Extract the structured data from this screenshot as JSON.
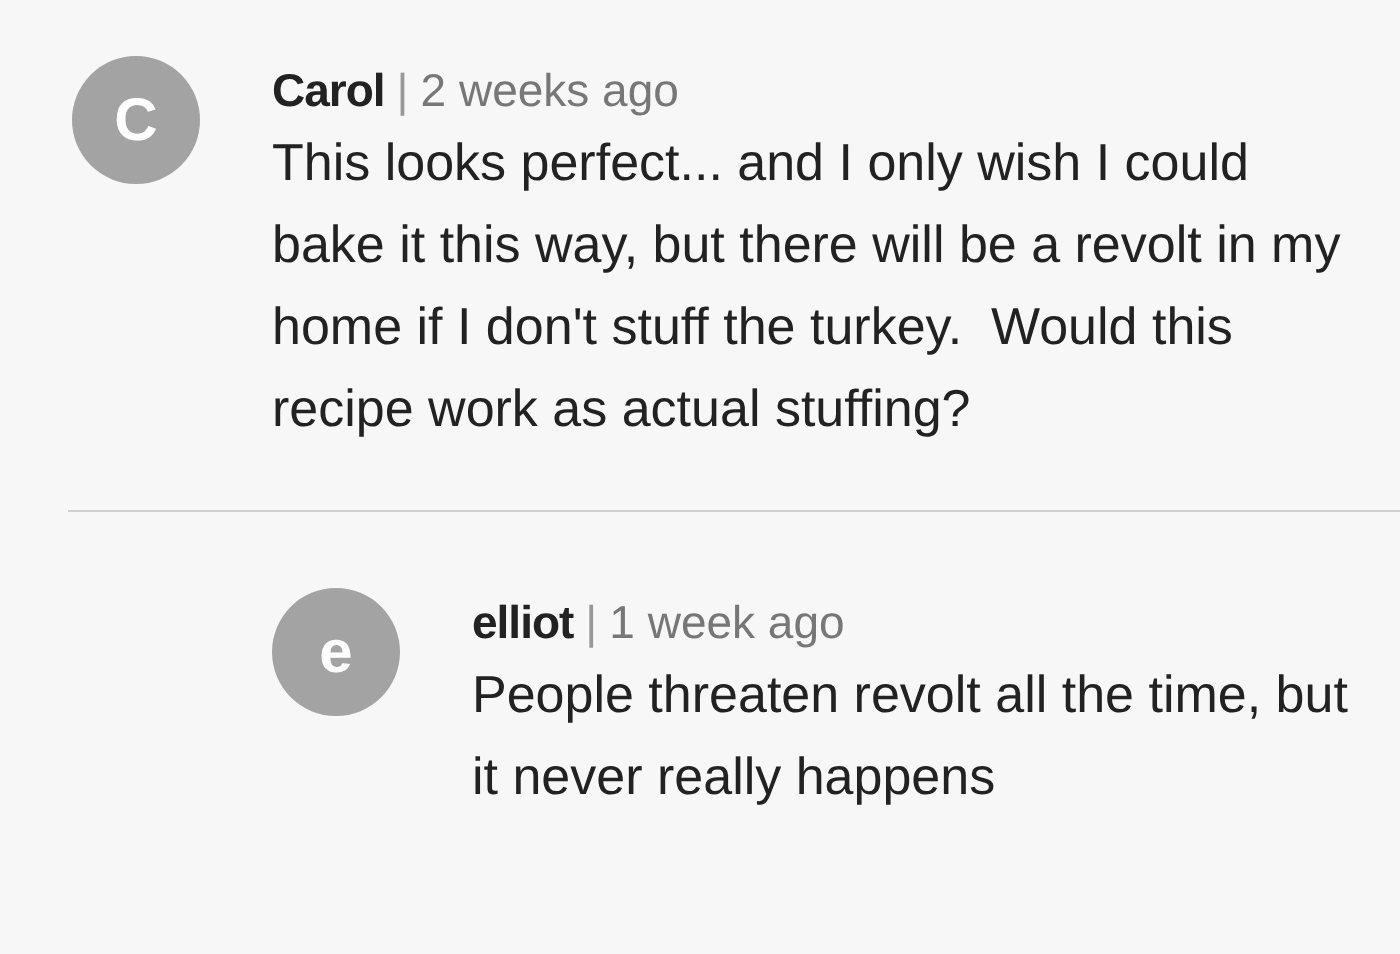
{
  "comments": [
    {
      "avatar_letter": "C",
      "author": "Carol",
      "separator": "|",
      "time": "2 weeks ago",
      "text": "This looks perfect... and I only wish I could bake it this way, but there will be a revolt in my home if I don't stuff the turkey.  Would this recipe work as actual stuffing?",
      "replies": [
        {
          "avatar_letter": "e",
          "author": "elliot",
          "separator": "|",
          "time": "1 week ago",
          "text": "People threaten revolt all the time, but it never really happens"
        }
      ]
    }
  ]
}
